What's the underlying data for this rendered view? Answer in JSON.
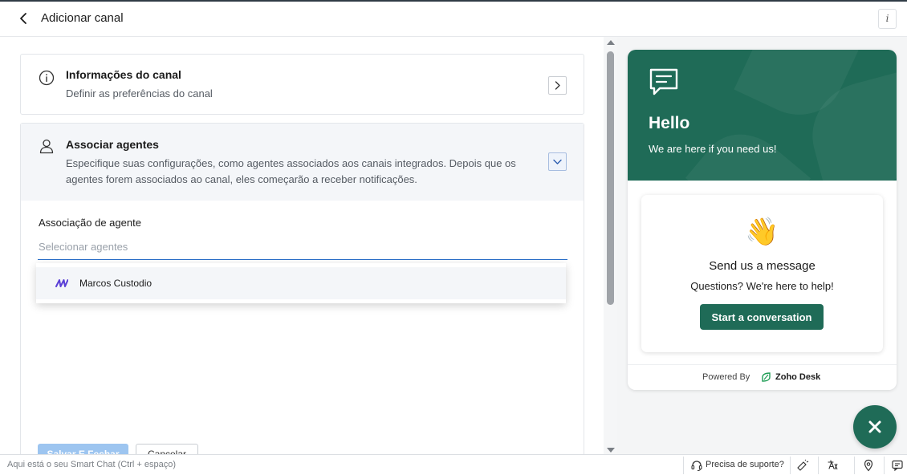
{
  "header": {
    "title": "Adicionar canal",
    "info_label": "i"
  },
  "channel_info": {
    "title": "Informações do canal",
    "subtitle": "Definir as preferências do canal"
  },
  "agents": {
    "title": "Associar agentes",
    "description": "Especifique suas configurações, como agentes associados aos canais integrados. Depois que os agentes forem associados ao canal, eles começarão a receber notificações.",
    "field_label": "Associação de agente",
    "field_placeholder": "Selecionar agentes",
    "field_value": "",
    "options": [
      {
        "name": "Marcos Custodio"
      }
    ]
  },
  "actions": {
    "save_label": "Salvar E Fechar",
    "cancel_label": "Cancelar"
  },
  "widget": {
    "hello": "Hello",
    "subtitle": "We are here if you need us!",
    "wave": "👋",
    "send_title": "Send us a message",
    "send_sub": "Questions? We're here to help!",
    "start_label": "Start a conversation",
    "powered_by": "Powered By",
    "brand": "Zoho Desk",
    "accent_color": "#1f6b57"
  },
  "bottom_bar": {
    "smart_chat_placeholder": "Aqui está o seu Smart Chat (Ctrl + espaço)",
    "support_label": "Precisa de suporte?"
  }
}
